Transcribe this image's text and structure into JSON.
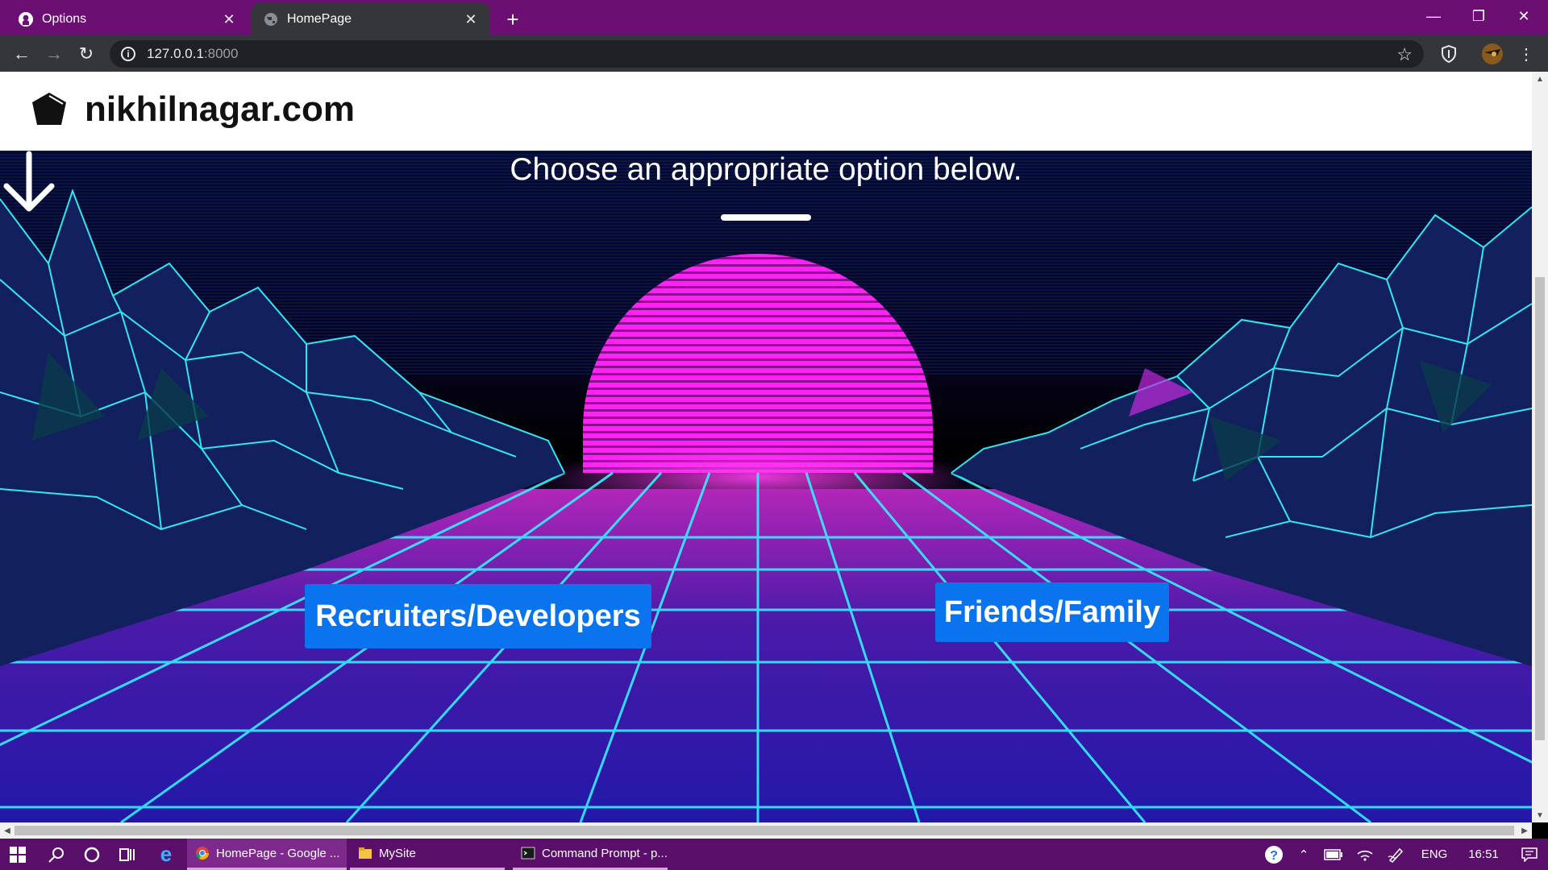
{
  "browser": {
    "tabs": [
      {
        "label": "Options",
        "icon": "github-icon"
      },
      {
        "label": "HomePage",
        "icon": "globe-icon",
        "active": true
      }
    ],
    "url_host": "127.0.0.1",
    "url_port": ":8000"
  },
  "site": {
    "name": "nikhilnagar.com",
    "prompt": "Choose an appropriate option below.",
    "buttons": {
      "recruiters": "Recruiters/Developers",
      "friends": "Friends/Family"
    },
    "colors": {
      "button": "#0a73ee",
      "sun": "#ff1aff",
      "grid": "#33f0ff"
    }
  },
  "taskbar": {
    "apps": [
      {
        "label": "HomePage - Google ..."
      },
      {
        "label": "MySite"
      },
      {
        "label": "Command Prompt - p..."
      }
    ],
    "language": "ENG",
    "time": "16:51"
  }
}
